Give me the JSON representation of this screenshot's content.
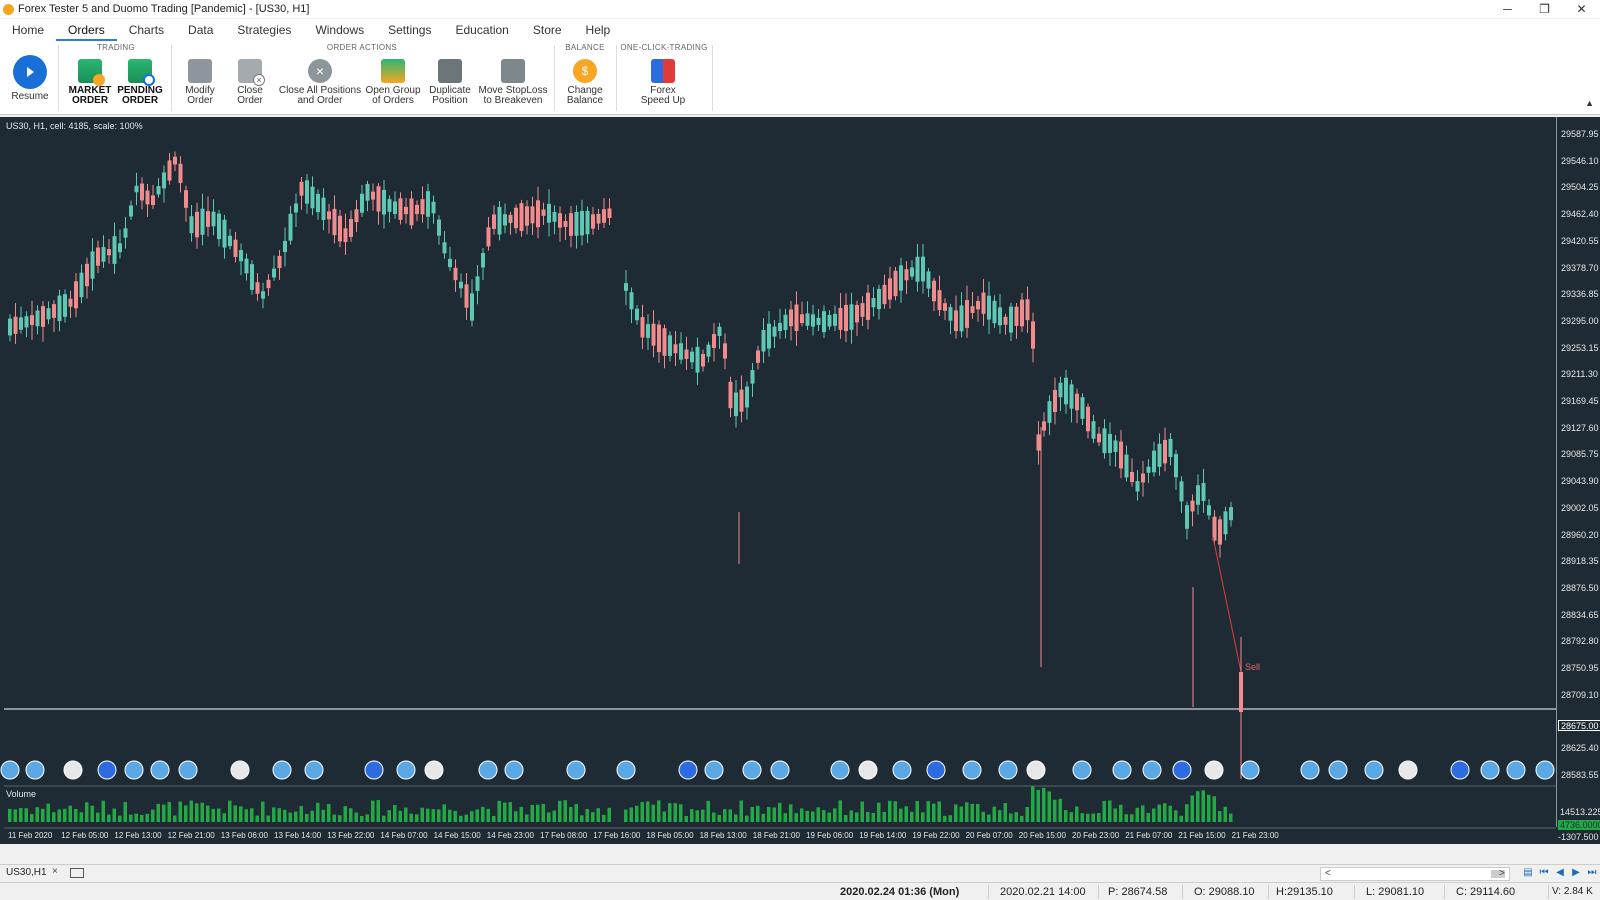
{
  "window": {
    "title": "Forex Tester 5 and Duomo Trading  [Pandemic] - [US30, H1]"
  },
  "menu": {
    "tabs": [
      "Home",
      "Orders",
      "Charts",
      "Data",
      "Strategies",
      "Windows",
      "Settings",
      "Education",
      "Store",
      "Help"
    ],
    "active": "Orders"
  },
  "ribbon": {
    "groups": {
      "trading": "TRADING",
      "order_actions": "ORDER ACTIONS",
      "balance": "BALANCE",
      "one_click": "ONE-CLICK-TRADING"
    },
    "resume": "Resume",
    "market_order_1": "MARKET",
    "market_order_2": "ORDER",
    "pending_order_1": "PENDING",
    "pending_order_2": "ORDER",
    "modify_order_1": "Modify",
    "modify_order_2": "Order",
    "close_order_1": "Close",
    "close_order_2": "Order",
    "close_all_1": "Close All Positions",
    "close_all_2": "and Order",
    "open_group_1": "Open Group",
    "open_group_2": "of Orders",
    "duplicate_1": "Duplicate",
    "duplicate_2": "Position",
    "move_sl_1": "Move StopLoss",
    "move_sl_2": "to Breakeven",
    "change_balance_1": "Change",
    "change_balance_2": "Balance",
    "speed_up_1": "Forex",
    "speed_up_2": "Speed Up"
  },
  "chart": {
    "info": "US30, H1, cell: 4185, scale: 100%",
    "price_ticks": [
      "29587.95",
      "29546.10",
      "29504.25",
      "29462.40",
      "29420.55",
      "29378.70",
      "29336.85",
      "29295.00",
      "29253.15",
      "29211.30",
      "29169.45",
      "29127.60",
      "29085.75",
      "29043.90",
      "29002.05",
      "28960.20",
      "28918.35",
      "28876.50",
      "28834.65",
      "28792.80",
      "28750.95",
      "28709.10",
      "28625.40",
      "28583.55"
    ],
    "current_price": "28675.00",
    "sell_label": "Sell",
    "volume_label": "Volume",
    "volume_ticks": [
      "14513.225",
      "4736.0000",
      "-1307.500"
    ],
    "time_ticks": [
      "11 Feb 2020",
      "12 Feb 05:00",
      "12 Feb 13:00",
      "12 Feb 21:00",
      "13 Feb 06:00",
      "13 Feb 14:00",
      "13 Feb 22:00",
      "14 Feb 07:00",
      "14 Feb 15:00",
      "14 Feb 23:00",
      "17 Feb 08:00",
      "17 Feb 16:00",
      "18 Feb 05:00",
      "18 Feb 13:00",
      "18 Feb 21:00",
      "19 Feb 06:00",
      "19 Feb 14:00",
      "19 Feb 22:00",
      "20 Feb 07:00",
      "20 Feb 15:00",
      "20 Feb 23:00",
      "21 Feb 07:00",
      "21 Feb 15:00",
      "21 Feb 23:00"
    ],
    "colors": {
      "background": "#1e2b35",
      "bull": "#5fc8b4",
      "bear": "#f28b8b",
      "volume": "#22a946"
    }
  },
  "tabbar": {
    "chart_tab": "US30,H1",
    "close": "×"
  },
  "status": {
    "datetime": "2020.02.24 01:36 (Mon)",
    "bar_time": "2020.02.21 14:00",
    "p": "P: 28674.58",
    "o": "O: 29088.10",
    "h": "H:29135.10",
    "l": "L: 29081.10",
    "c": "C: 29114.60",
    "v": "V: 2.84 K"
  }
}
